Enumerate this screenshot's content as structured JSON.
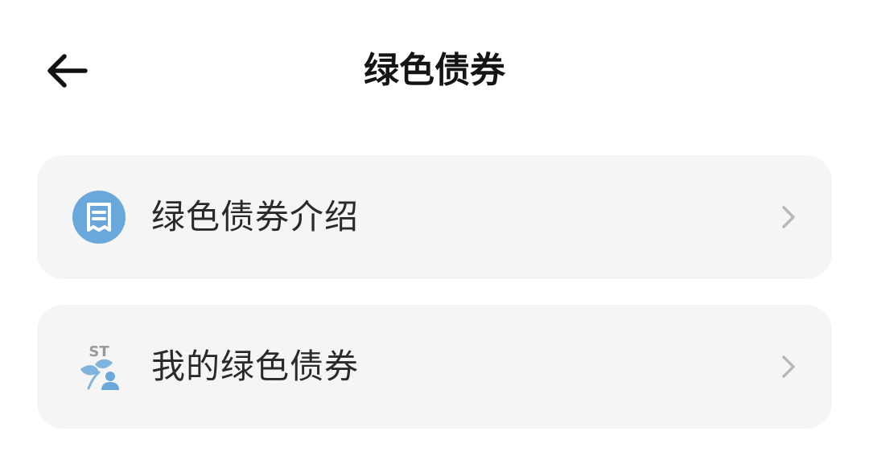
{
  "header": {
    "title": "绿色债券",
    "back_icon": "back-arrow-icon"
  },
  "menu": {
    "items": [
      {
        "label": "绿色债券介绍",
        "icon": "document-icon",
        "icon_color": "#6aa8dc",
        "chevron_icon": "chevron-right-icon"
      },
      {
        "label": "我的绿色债券",
        "icon": "st-leaf-user-icon",
        "icon_badge_text": "ST",
        "icon_color": "#7fb4df",
        "chevron_icon": "chevron-right-icon"
      }
    ]
  },
  "colors": {
    "background": "#ffffff",
    "card_background": "#f5f5f5",
    "title_text": "#141414",
    "chevron": "#b8b8b8"
  }
}
